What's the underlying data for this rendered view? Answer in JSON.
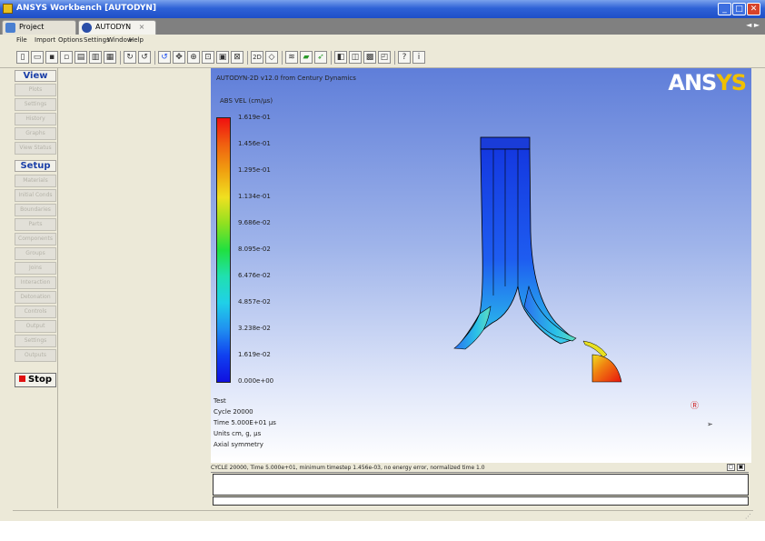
{
  "window": {
    "title": "ANSYS Workbench [AUTODYN]",
    "minimize": "_",
    "maximize": "□",
    "close": "✕"
  },
  "tabs": [
    {
      "label": "Project",
      "icon": "project-icon"
    },
    {
      "label": "AUTODYN",
      "icon": "autodyn-icon",
      "close": "×"
    }
  ],
  "tab_scroll": "◄ ►",
  "menu": [
    "File",
    "Import",
    "Options",
    "Settings",
    "Window",
    "Help"
  ],
  "left_panel": {
    "view_heading": "View",
    "view_items": [
      "Plots",
      "Settings",
      "History",
      "Graphs",
      "View Status"
    ],
    "setup_heading": "Setup",
    "setup_items": [
      "Materials",
      "Initial Conds",
      "Boundaries",
      "Parts",
      "Components",
      "Groups",
      "Joins",
      "Interaction",
      "Detonation",
      "Controls",
      "Output",
      "Settings",
      "Outputs"
    ],
    "stop_label": "Stop"
  },
  "viewport": {
    "title": "AUTODYN-2D v12.0 from Century Dynamics",
    "brand": {
      "main": "ANS",
      "accent": "YS"
    },
    "legend_label": "ABS VEL (cm/μs)",
    "legend_ticks": [
      "1.619e-01",
      "1.456e-01",
      "1.295e-01",
      "1.134e-01",
      "9.686e-02",
      "8.095e-02",
      "6.476e-02",
      "4.857e-02",
      "3.238e-02",
      "1.619e-02",
      "0.000e+00"
    ],
    "info": [
      "Test",
      "Cycle 20000",
      "Time 5.000E+01 μs",
      "Units cm, g, μs",
      "Axial symmetry"
    ]
  },
  "message": {
    "header": "CYCLE 20000, Time 5.000e+01, minimum timestep 1.456e-03, no energy error, normalized time 1.0",
    "btn1": "▢",
    "btn2": "▣"
  },
  "colors": {
    "accent": "#2f62d6",
    "legend_top": "#f01010",
    "legend_bottom": "#1010e0",
    "part_red": "#e8140e",
    "part_blue": "#1a4cf0"
  }
}
